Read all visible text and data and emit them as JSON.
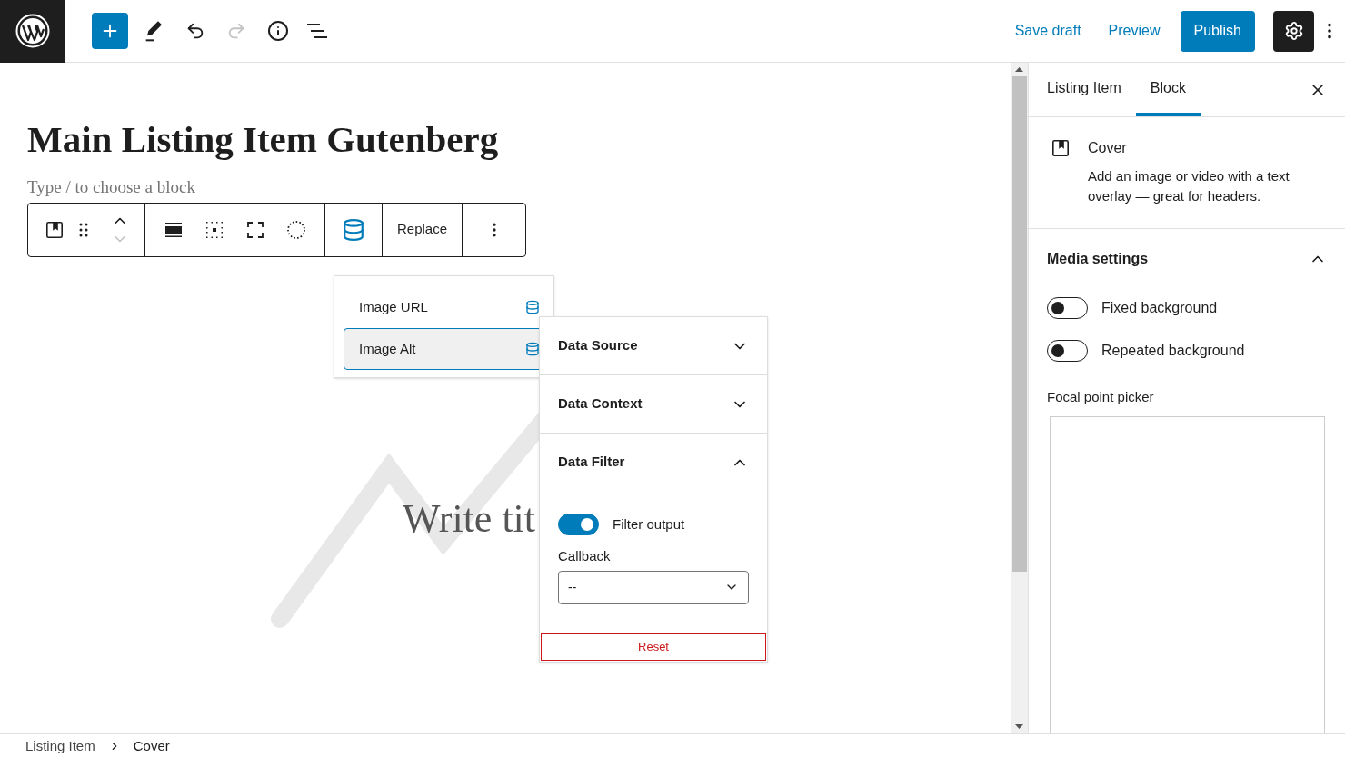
{
  "top_bar": {
    "history": [
      {
        "kind": "undo",
        "disabled": false
      },
      {
        "kind": "redo",
        "disabled": true
      }
    ],
    "save_draft": "Save draft",
    "preview": "Preview",
    "publish": "Publish",
    "settings": {
      "on": true
    }
  },
  "editor": {
    "title": "Main Listing Item Gutenberg",
    "placeholder": "Type / to choose a block",
    "cover_title": "Write tit",
    "block_toolbar": {
      "move": [
        {
          "kind": "up",
          "disabled": false
        },
        {
          "kind": "down",
          "disabled": true
        }
      ],
      "replace": "Replace"
    }
  },
  "binding_menu": {
    "items": [
      {
        "label": "Image URL",
        "selected": false
      },
      {
        "label": "Image Alt",
        "selected": true
      }
    ]
  },
  "data_panel": {
    "sections": [
      {
        "title": "Data Source",
        "expanded": false
      },
      {
        "title": "Data Context",
        "expanded": false
      },
      {
        "title": "Data Filter",
        "expanded": true
      }
    ],
    "filter_toggle": {
      "label": "Filter output",
      "on": true
    },
    "callback": {
      "label": "Callback",
      "value": "--"
    },
    "reset": "Reset"
  },
  "sidebar": {
    "tabs": [
      {
        "label": "Listing Item",
        "selected": false
      },
      {
        "label": "Block",
        "selected": true
      }
    ],
    "block": {
      "name": "Cover",
      "description": "Add an image or video with a text overlay — great for headers."
    },
    "media_settings": {
      "title": "Media settings",
      "expanded": true,
      "toggles": [
        {
          "label": "Fixed background",
          "on": false
        },
        {
          "label": "Repeated background",
          "on": false
        }
      ],
      "focal_label": "Focal point picker"
    }
  },
  "breadcrumb": [
    "Listing Item",
    "Cover"
  ]
}
